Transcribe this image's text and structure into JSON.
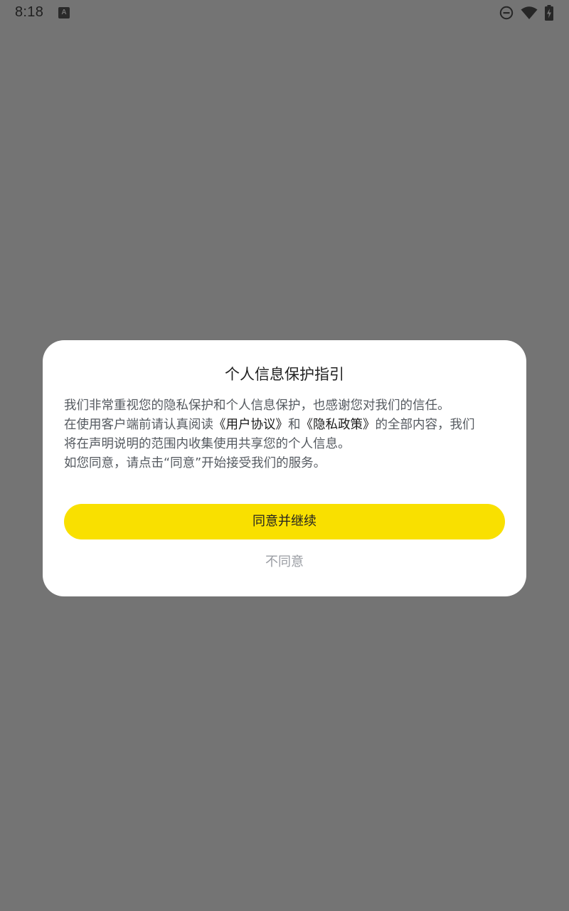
{
  "status_bar": {
    "time": "8:18",
    "notification_icon": "font-a-icon",
    "icons": [
      "do-not-disturb-icon",
      "wifi-icon",
      "battery-charging-icon"
    ]
  },
  "dialog": {
    "title": "个人信息保护指引",
    "body": {
      "line1": "我们非常重视您的隐私保护和个人信息保护，也感谢您对我们的信任。",
      "line2_prefix": "在使用客户端前请认真阅读",
      "user_agreement": "《用户协议》",
      "line2_and": "和",
      "privacy_policy": "《隐私政策》",
      "line2_suffix": "的全部内容，我们",
      "line3": "将在声明说明的范围内收集使用共享您的个人信息。",
      "line4": "如您同意，请点击“同意”开始接受我们的服务。"
    },
    "agree_label": "同意并继续",
    "disagree_label": "不同意"
  },
  "colors": {
    "overlay": "#747474",
    "accent": "#f9e000",
    "dialog_bg": "#ffffff",
    "secondary_text": "#9a9da3"
  }
}
